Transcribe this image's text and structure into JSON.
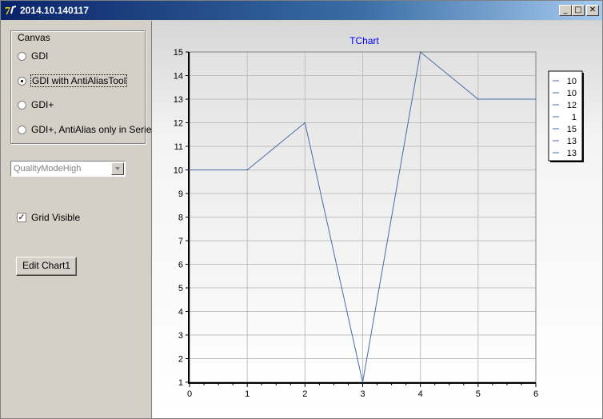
{
  "window": {
    "title": "2014.10.140117",
    "minimize_label": "_",
    "maximize_label": "□",
    "close_label": "✕"
  },
  "canvas_group": {
    "label": "Canvas",
    "options": [
      {
        "label": "GDI",
        "selected": false
      },
      {
        "label": "GDI with AntiAliasTool",
        "selected": true
      },
      {
        "label": "GDI+",
        "selected": false
      },
      {
        "label": "GDI+, AntiAlias only in Series",
        "selected": false
      }
    ]
  },
  "quality_combo": {
    "value": "QualityModeHigh",
    "enabled": false
  },
  "grid_visible": {
    "label": "Grid Visible",
    "checked": true
  },
  "edit_button": {
    "label": "Edit Chart1"
  },
  "chart_data": {
    "type": "line",
    "title": "TChart",
    "xlabel": "",
    "ylabel": "",
    "x": [
      0,
      1,
      2,
      3,
      4,
      5,
      6
    ],
    "series": [
      {
        "values": [
          10,
          10,
          12,
          1,
          15,
          13,
          13
        ],
        "color": "#4a6aa8"
      }
    ],
    "xlim": [
      0,
      6
    ],
    "ylim": [
      1,
      15
    ],
    "grid": true,
    "legend_placement": "right",
    "legend_entries": [
      "10",
      "10",
      "12",
      "1",
      "15",
      "13",
      "13"
    ]
  }
}
